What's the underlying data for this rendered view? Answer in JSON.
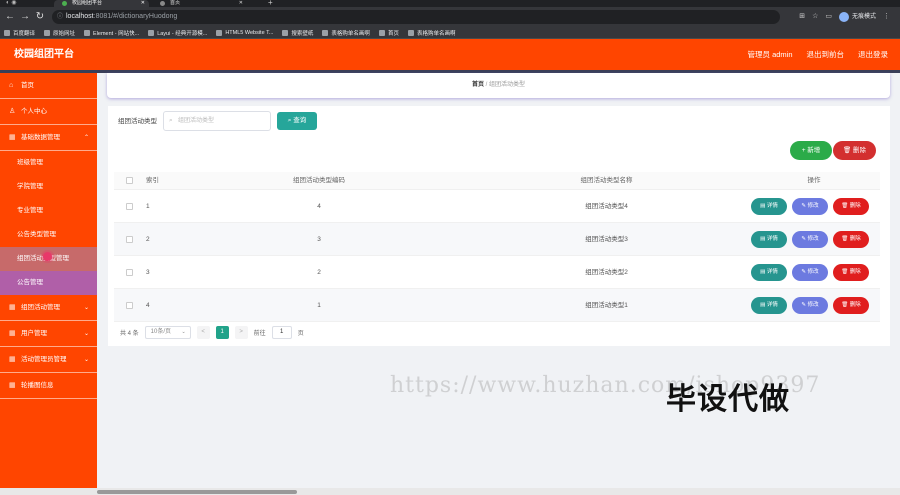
{
  "browser": {
    "tabs": [
      {
        "title": "校园组团平台",
        "active": true
      },
      {
        "title": "首页",
        "active": false
      }
    ],
    "url_host": "localhost",
    "url_path": ":8081/#/dictionaryHuodong",
    "profile_label": "无痕模式",
    "bookmarks": [
      "百度翻译",
      "原始网址",
      "Element - 网站快...",
      "Layui - 经典开源模...",
      "HTML5 Website T...",
      "搜索壁纸",
      "表格购单名画啊",
      "首页",
      "表格购单名画啊"
    ]
  },
  "header": {
    "brand": "校园组团平台",
    "user": "管理员 admin",
    "back_home": "退出到前台",
    "logout": "退出登录"
  },
  "sidebar": {
    "items": [
      {
        "label": "首页",
        "icon": "home-icon"
      },
      {
        "label": "个人中心",
        "icon": "user-icon"
      },
      {
        "label": "基础数据管理",
        "icon": "grid-icon",
        "expanded": true
      }
    ],
    "sub_items": [
      "班级管理",
      "学院管理",
      "专业管理",
      "公告类型管理",
      "组团活动类型管理",
      "公告管理"
    ],
    "items_after": [
      {
        "label": "组团活动管理"
      },
      {
        "label": "用户管理"
      },
      {
        "label": "活动管理员管理"
      },
      {
        "label": "轮播图信息"
      }
    ]
  },
  "breadcrumb": {
    "home": "首页",
    "separator": "/",
    "current": "组团活动类型"
  },
  "search": {
    "label": "组团活动类型",
    "placeholder": "组团活动类型",
    "button": "查询"
  },
  "actions": {
    "add": "新增",
    "delete": "删除"
  },
  "table": {
    "headers": [
      "索引",
      "组团活动类型编码",
      "组团活动类型名称",
      "操作"
    ],
    "rows": [
      {
        "index": "1",
        "code": "4",
        "name": "组团活动类型4"
      },
      {
        "index": "2",
        "code": "3",
        "name": "组团活动类型3"
      },
      {
        "index": "3",
        "code": "2",
        "name": "组团活动类型2"
      },
      {
        "index": "4",
        "code": "1",
        "name": "组团活动类型1"
      }
    ],
    "row_ops": {
      "detail": "详情",
      "edit": "修改",
      "delete": "删除"
    }
  },
  "pagination": {
    "total": "共 4 条",
    "page_size": "10条/页",
    "prev": "<",
    "current": "1",
    "next": ">",
    "goto_label": "前往",
    "goto_value": "1",
    "page_suffix": "页"
  },
  "watermark": {
    "url": "https://www.huzhan.com/ishop9397",
    "text": "毕设代做"
  },
  "colors": {
    "brand": "#ff4500",
    "search_btn": "#26a69a",
    "add_btn": "#2bab49",
    "delete_btn": "#e01e1e",
    "edit_btn": "#6c7ae0",
    "detail_btn": "#26958f"
  }
}
